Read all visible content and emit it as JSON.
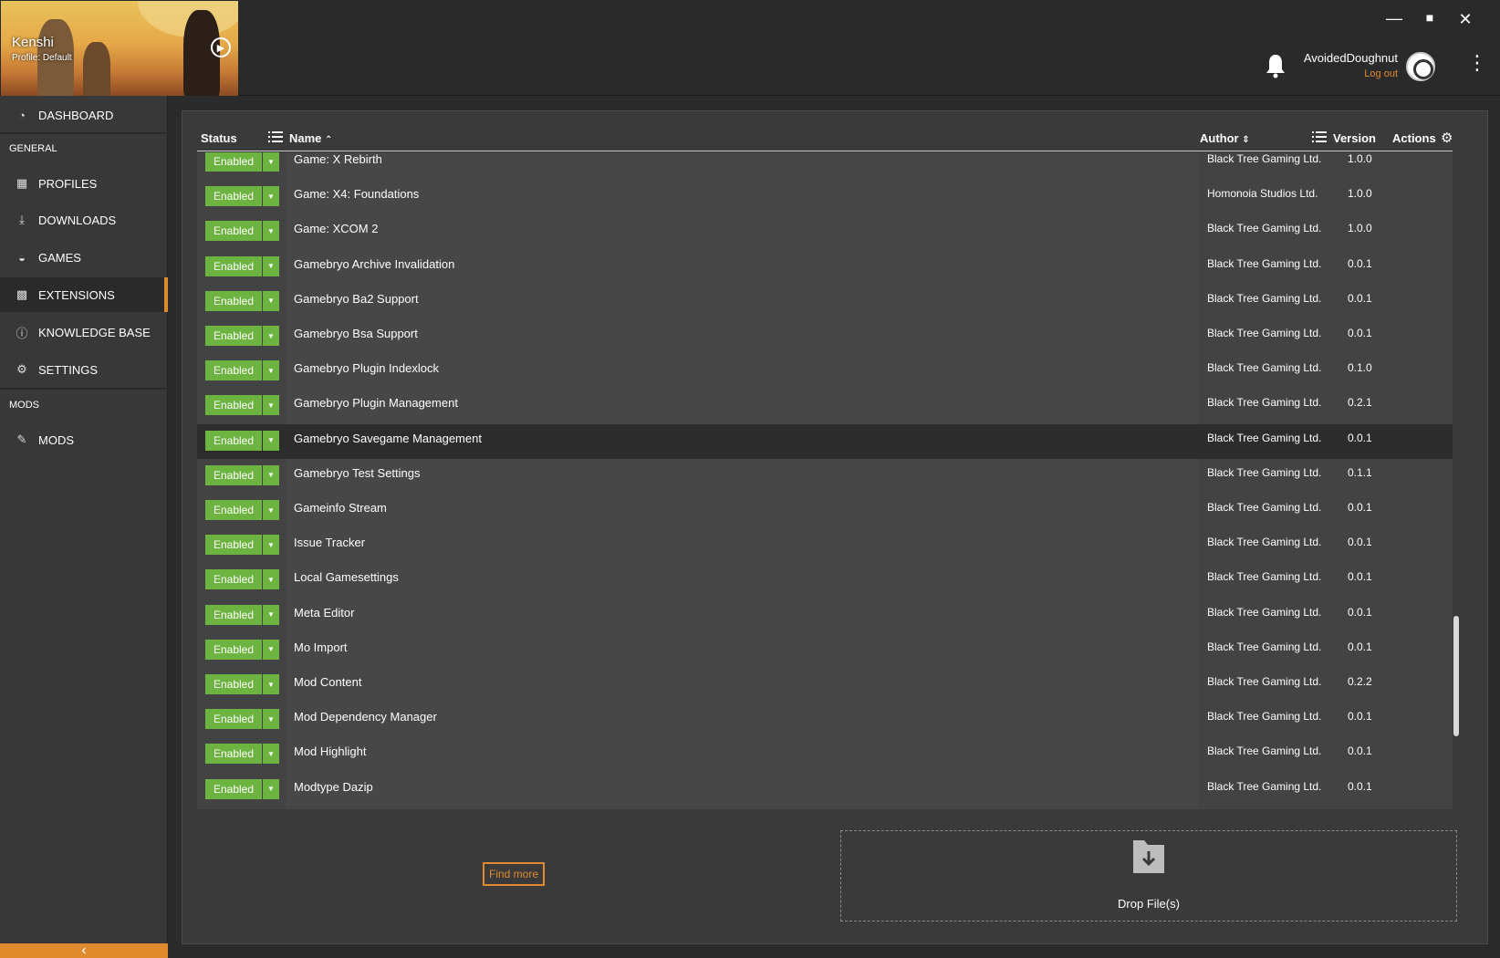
{
  "window": {
    "minimize": "—",
    "maximize": "■",
    "close": "✕"
  },
  "banner": {
    "game": "Kenshi",
    "profile": "Profile: Default"
  },
  "user": {
    "name": "AvoidedDoughnut",
    "logout": "Log out"
  },
  "sidebar": {
    "dashboard": "DASHBOARD",
    "section_general": "GENERAL",
    "profiles": "PROFILES",
    "downloads": "DOWNLOADS",
    "games": "GAMES",
    "extensions": "EXTENSIONS",
    "knowledge_base": "KNOWLEDGE BASE",
    "settings": "SETTINGS",
    "section_mods": "MODS",
    "mods": "MODS"
  },
  "table": {
    "headers": {
      "status": "Status",
      "name": "Name",
      "author": "Author",
      "version": "Version",
      "actions": "Actions"
    },
    "status_label": "Enabled",
    "rows": [
      {
        "name": "Game: X Rebirth",
        "author": "Black Tree Gaming Ltd.",
        "version": "1.0.0"
      },
      {
        "name": "Game: X4: Foundations",
        "author": "Homonoia Studios Ltd.",
        "version": "1.0.0"
      },
      {
        "name": "Game: XCOM 2",
        "author": "Black Tree Gaming Ltd.",
        "version": "1.0.0"
      },
      {
        "name": "Gamebryo Archive Invalidation",
        "author": "Black Tree Gaming Ltd.",
        "version": "0.0.1"
      },
      {
        "name": "Gamebryo Ba2 Support",
        "author": "Black Tree Gaming Ltd.",
        "version": "0.0.1"
      },
      {
        "name": "Gamebryo Bsa Support",
        "author": "Black Tree Gaming Ltd.",
        "version": "0.0.1"
      },
      {
        "name": "Gamebryo Plugin Indexlock",
        "author": "Black Tree Gaming Ltd.",
        "version": "0.1.0"
      },
      {
        "name": "Gamebryo Plugin Management",
        "author": "Black Tree Gaming Ltd.",
        "version": "0.2.1"
      },
      {
        "name": "Gamebryo Savegame Management",
        "author": "Black Tree Gaming Ltd.",
        "version": "0.0.1"
      },
      {
        "name": "Gamebryo Test Settings",
        "author": "Black Tree Gaming Ltd.",
        "version": "0.1.1"
      },
      {
        "name": "Gameinfo Stream",
        "author": "Black Tree Gaming Ltd.",
        "version": "0.0.1"
      },
      {
        "name": "Issue Tracker",
        "author": "Black Tree Gaming Ltd.",
        "version": "0.0.1"
      },
      {
        "name": "Local Gamesettings",
        "author": "Black Tree Gaming Ltd.",
        "version": "0.0.1"
      },
      {
        "name": "Meta Editor",
        "author": "Black Tree Gaming Ltd.",
        "version": "0.0.1"
      },
      {
        "name": "Mo Import",
        "author": "Black Tree Gaming Ltd.",
        "version": "0.0.1"
      },
      {
        "name": "Mod Content",
        "author": "Black Tree Gaming Ltd.",
        "version": "0.2.2"
      },
      {
        "name": "Mod Dependency Manager",
        "author": "Black Tree Gaming Ltd.",
        "version": "0.0.1"
      },
      {
        "name": "Mod Highlight",
        "author": "Black Tree Gaming Ltd.",
        "version": "0.0.1"
      },
      {
        "name": "Modtype Dazip",
        "author": "Black Tree Gaming Ltd.",
        "version": "0.0.1"
      }
    ]
  },
  "footer": {
    "find_more": "Find more",
    "drop_files": "Drop File(s)"
  },
  "colors": {
    "accent": "#e08a2e",
    "enabled": "#6db33f"
  }
}
